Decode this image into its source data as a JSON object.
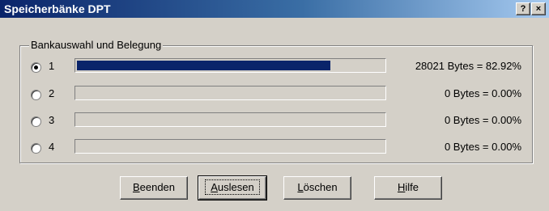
{
  "window": {
    "title": "Speicherbänke DPT",
    "help_label": "?",
    "close_label": "×"
  },
  "group": {
    "legend": "Bankauswahl und Belegung"
  },
  "banks": [
    {
      "label": "1",
      "selected": true,
      "fill_percent": 82.92,
      "stat": "28021 Bytes =  82.92%"
    },
    {
      "label": "2",
      "selected": false,
      "fill_percent": 0,
      "stat": "0 Bytes =  0.00%"
    },
    {
      "label": "3",
      "selected": false,
      "fill_percent": 0,
      "stat": "0 Bytes =  0.00%"
    },
    {
      "label": "4",
      "selected": false,
      "fill_percent": 0,
      "stat": "0 Bytes =  0.00%"
    }
  ],
  "buttons": {
    "beenden": {
      "mnemonic": "B",
      "rest": "eenden"
    },
    "auslesen": {
      "mnemonic": "A",
      "rest": "uslesen"
    },
    "loeschen": {
      "mnemonic": "L",
      "rest": "öschen"
    },
    "hilfe": {
      "mnemonic": "H",
      "rest": "ilfe"
    }
  },
  "colors": {
    "progress_fill": "#0a246a",
    "title_start": "#0a246a",
    "title_end": "#a6caf0"
  }
}
